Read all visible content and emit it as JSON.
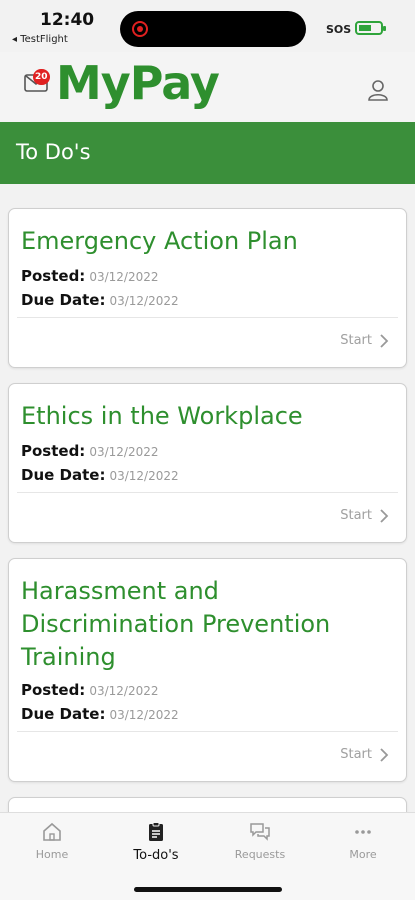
{
  "status_bar": {
    "time": "12:40",
    "back_app": "◂ TestFlight",
    "carrier": "SOS"
  },
  "header": {
    "app_title": "MyPay",
    "mail_badge": "20"
  },
  "section": {
    "title": "To Do's"
  },
  "todos": [
    {
      "title": "Emergency Action Plan",
      "posted_label": "Posted:",
      "posted": "03/12/2022",
      "due_label": "Due Date:",
      "due": "03/12/2022",
      "action": "Start"
    },
    {
      "title": "Ethics in the Workplace",
      "posted_label": "Posted:",
      "posted": "03/12/2022",
      "due_label": "Due Date:",
      "due": "03/12/2022",
      "action": "Start"
    },
    {
      "title": "Harassment and Discrimination Prevention Training",
      "posted_label": "Posted:",
      "posted": "03/12/2022",
      "due_label": "Due Date:",
      "due": "03/12/2022",
      "action": "Start"
    }
  ],
  "tabs": [
    {
      "label": "Home",
      "icon": "home-icon"
    },
    {
      "label": "To-do's",
      "icon": "clipboard-icon",
      "active": true
    },
    {
      "label": "Requests",
      "icon": "chat-icon"
    },
    {
      "label": "More",
      "icon": "ellipsis-icon"
    }
  ],
  "colors": {
    "brand_green": "#2e8f2e",
    "bar_green": "#3b8f3b",
    "badge_red": "#e02020"
  }
}
